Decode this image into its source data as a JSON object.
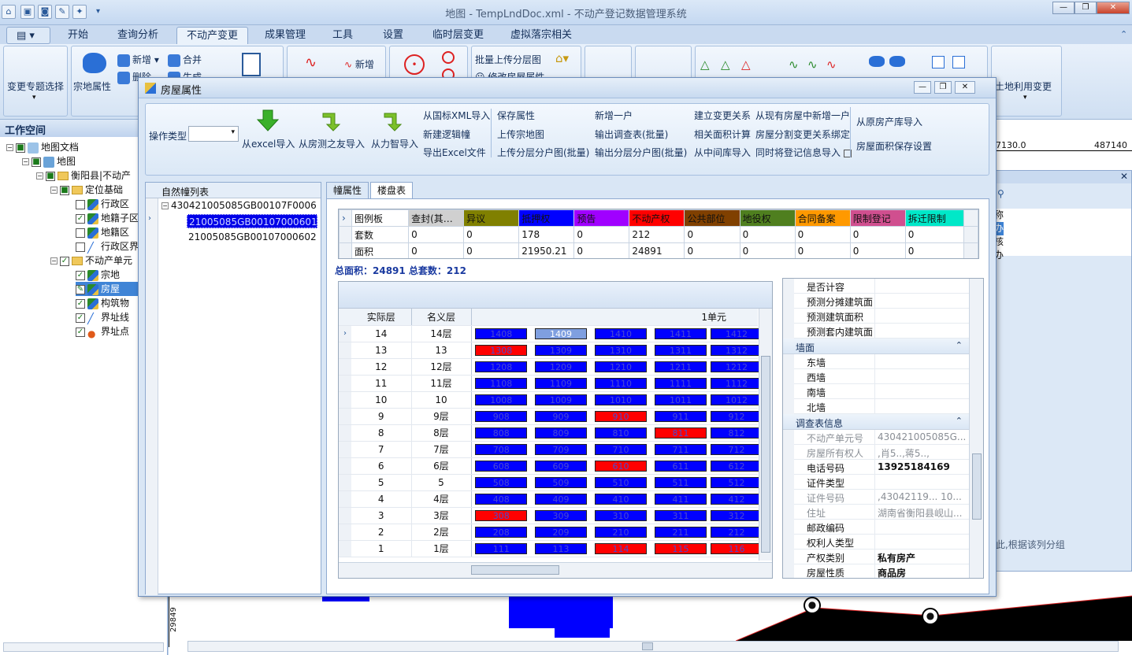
{
  "app": {
    "title": "地图 - TempLndDoc.xml - 不动产登记数据管理系统",
    "tabs": [
      "开始",
      "查询分析",
      "不动产变更",
      "成果管理",
      "工具",
      "设置",
      "临时层变更",
      "虚拟落宗相关"
    ],
    "active_tab": "不动产变更"
  },
  "ribbon": {
    "change_topic": "变更专题选择",
    "parcel_attr": "宗地属性",
    "add": "新增",
    "delete": "删除",
    "merge": "合并",
    "generate": "生成",
    "add2": "新增",
    "batch_upload": "批量上传分层图",
    "modify_house": "修改房屋属性",
    "land_use_change": "土地利用变更"
  },
  "workspace": {
    "title": "工作空间",
    "nodes": [
      "地图文档",
      "地图",
      "衡阳县|不动产",
      "定位基础",
      "行政区",
      "地籍子区",
      "地籍区",
      "行政区界",
      "不动产单元",
      "宗地",
      "房屋",
      "构筑物",
      "界址线",
      "界址点"
    ]
  },
  "dialog": {
    "title": "房屋属性",
    "op_type_label": "操作类型",
    "buttons": {
      "excel_import": "从excel导入",
      "fangce_import": "从房测之友导入",
      "lizhi_import": "从力智导入",
      "guobiao_xml": "从国标XML导入",
      "new_logic": "新建逻辑幢",
      "export_excel": "导出Excel文件",
      "save_attr": "保存属性",
      "upload_parcel": "上传宗地图",
      "upload_floor": "上传分层分户图(批量)",
      "add_one": "新增一户",
      "output_survey": "输出调查表(批量)",
      "output_floor": "输出分层分户图(批量)",
      "build_relation": "建立变更关系",
      "related_area": "相关面积计算",
      "from_middle": "从中间库导入",
      "from_existing": "从现有房屋中新增一户",
      "split_bind": "房屋分割变更关系绑定",
      "import_reg": "同时将登记信息导入",
      "from_old": "从原房产库导入",
      "area_settings": "房屋面积保存设置"
    },
    "list_header": "自然幢列表",
    "list_items": [
      "430421005085GB00107F0006",
      "21005085GB00107000601",
      "21005085GB00107000602"
    ],
    "sub_tabs": [
      "幢属性",
      "楼盘表"
    ],
    "legend": {
      "header": [
        "图例板",
        "查封(其…",
        "异议",
        "抵押权",
        "预告",
        "不动产权",
        "公共部位",
        "地役权",
        "合同备案",
        "限制登记",
        "拆迁限制"
      ],
      "colors": [
        "#d0d0d0",
        "#808000",
        "#0000ff",
        "#a000ff",
        "#ff0000",
        "#804000",
        "#4f7f1f",
        "#ff9900",
        "#d04f8f",
        "#00e8c8"
      ],
      "rows": [
        {
          "label": "套数",
          "values": [
            "0",
            "0",
            "178",
            "0",
            "212",
            "0",
            "0",
            "0",
            "0",
            "0"
          ]
        },
        {
          "label": "面积",
          "values": [
            "0",
            "0",
            "21950.21",
            "0",
            "24891",
            "0",
            "0",
            "0",
            "0",
            "0"
          ]
        }
      ]
    },
    "summary": "总面积：24891  总套数：212",
    "floor_table": {
      "col_actual": "实际层",
      "col_nominal": "名义层",
      "unit": "1单元",
      "rows": [
        {
          "a": "14",
          "n": "14层",
          "c": [
            "1408",
            "1409",
            "1410",
            "1411",
            "1412"
          ],
          "s": [
            "b",
            "sel",
            "b",
            "b",
            "b"
          ]
        },
        {
          "a": "13",
          "n": "13",
          "c": [
            "1308",
            "1309",
            "1310",
            "1311",
            "1312"
          ],
          "s": [
            "r",
            "b",
            "b",
            "b",
            "b"
          ]
        },
        {
          "a": "12",
          "n": "12层",
          "c": [
            "1208",
            "1209",
            "1210",
            "1211",
            "1212"
          ],
          "s": [
            "b",
            "b",
            "b",
            "b",
            "b"
          ]
        },
        {
          "a": "11",
          "n": "11层",
          "c": [
            "1108",
            "1109",
            "1110",
            "1111",
            "1112"
          ],
          "s": [
            "b",
            "b",
            "b",
            "b",
            "b"
          ]
        },
        {
          "a": "10",
          "n": "10",
          "c": [
            "1008",
            "1009",
            "1010",
            "1011",
            "1012"
          ],
          "s": [
            "b",
            "b",
            "b",
            "b",
            "b"
          ]
        },
        {
          "a": "9",
          "n": "9层",
          "c": [
            "908",
            "909",
            "910",
            "911",
            "912"
          ],
          "s": [
            "b",
            "b",
            "r",
            "b",
            "b"
          ]
        },
        {
          "a": "8",
          "n": "8层",
          "c": [
            "808",
            "809",
            "810",
            "811",
            "812"
          ],
          "s": [
            "b",
            "b",
            "b",
            "r",
            "b"
          ]
        },
        {
          "a": "7",
          "n": "7层",
          "c": [
            "708",
            "709",
            "710",
            "711",
            "712"
          ],
          "s": [
            "b",
            "b",
            "b",
            "b",
            "b"
          ]
        },
        {
          "a": "6",
          "n": "6层",
          "c": [
            "608",
            "609",
            "610",
            "611",
            "612"
          ],
          "s": [
            "b",
            "b",
            "r",
            "b",
            "b"
          ]
        },
        {
          "a": "5",
          "n": "5",
          "c": [
            "508",
            "509",
            "510",
            "511",
            "512"
          ],
          "s": [
            "b",
            "b",
            "b",
            "b",
            "b"
          ]
        },
        {
          "a": "4",
          "n": "4层",
          "c": [
            "408",
            "409",
            "410",
            "411",
            "412"
          ],
          "s": [
            "b",
            "b",
            "b",
            "b",
            "b"
          ]
        },
        {
          "a": "3",
          "n": "3层",
          "c": [
            "308",
            "309",
            "310",
            "311",
            "312"
          ],
          "s": [
            "r",
            "b",
            "b",
            "b",
            "b"
          ]
        },
        {
          "a": "2",
          "n": "2层",
          "c": [
            "208",
            "209",
            "210",
            "211",
            "212"
          ],
          "s": [
            "b",
            "b",
            "b",
            "b",
            "b"
          ]
        },
        {
          "a": "1",
          "n": "1层",
          "c": [
            "111",
            "113",
            "114",
            "115",
            "116"
          ],
          "s": [
            "b",
            "b",
            "r",
            "r",
            "r"
          ]
        }
      ]
    },
    "props": {
      "top": [
        "是否计容",
        "预测分摊建筑面",
        "预测建筑面积",
        "预测套内建筑面"
      ],
      "wall_section": "墙面",
      "walls": [
        "东墙",
        "西墙",
        "南墙",
        "北墙"
      ],
      "survey_section": "调查表信息",
      "survey": [
        {
          "k": "不动产单元号",
          "v": "430421005085G...",
          "dim": true
        },
        {
          "k": "房屋所有权人",
          "v": ",肖5..,蒋5..,",
          "dim": true
        },
        {
          "k": "电话号码",
          "v": "13925184169",
          "bold": true
        },
        {
          "k": "证件类型",
          "v": ""
        },
        {
          "k": "证件号码",
          "v": ",43042119... 10...",
          "dim": true
        },
        {
          "k": "住址",
          "v": "湖南省衡阳县岘山...",
          "dim": true
        },
        {
          "k": "邮政编码",
          "v": ""
        },
        {
          "k": "权利人类型",
          "v": ""
        },
        {
          "k": "产权类别",
          "v": "私有房产",
          "bold": true
        },
        {
          "k": "房屋性质",
          "v": "商品房",
          "bold": true
        }
      ]
    }
  },
  "map": {
    "coord_left": "7130.0",
    "coord_right": "487140",
    "coord_y": "29849",
    "side_hint": "此,根据该列分组",
    "side_items": [
      "称",
      "办",
      "核",
      "办"
    ]
  }
}
